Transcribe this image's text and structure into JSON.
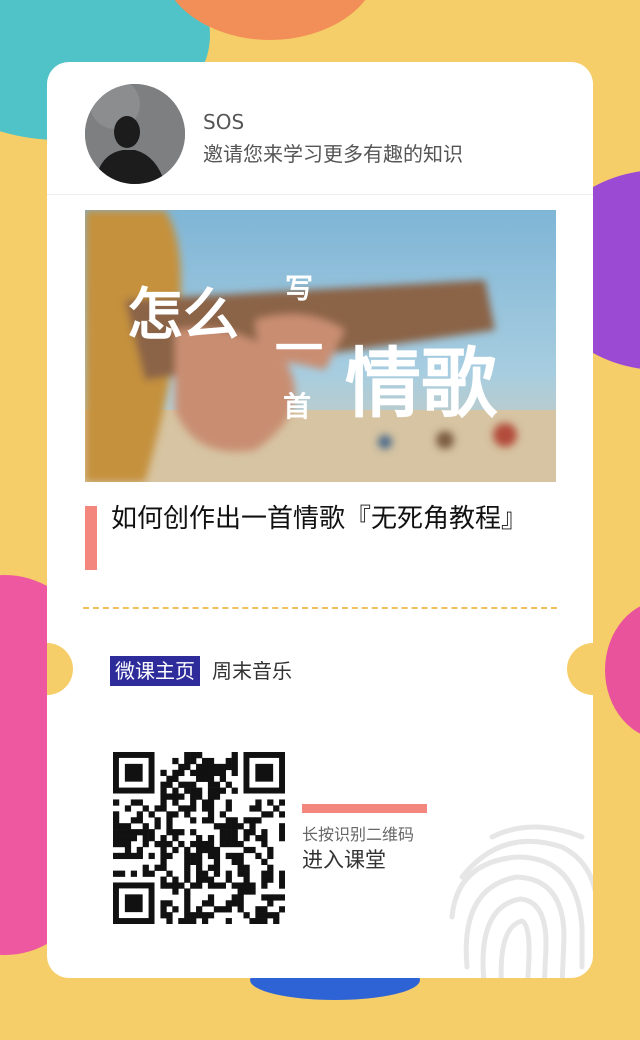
{
  "inviter": {
    "name": "SOS",
    "message": "邀请您来学习更多有趣的知识"
  },
  "cover": {
    "line1": "怎么",
    "small_chars": [
      "写",
      "一",
      "首"
    ],
    "big": "情歌"
  },
  "course": {
    "title": "如何创作出一首情歌『无死角教程』"
  },
  "homepage": {
    "badge": "微课主页",
    "brand": "周末音乐"
  },
  "qr": {
    "hint": "长按识别二维码",
    "action": "进入课堂"
  },
  "colors": {
    "background": "#f6ce69",
    "accent": "#f4877d",
    "badge": "#2d2c9a"
  }
}
